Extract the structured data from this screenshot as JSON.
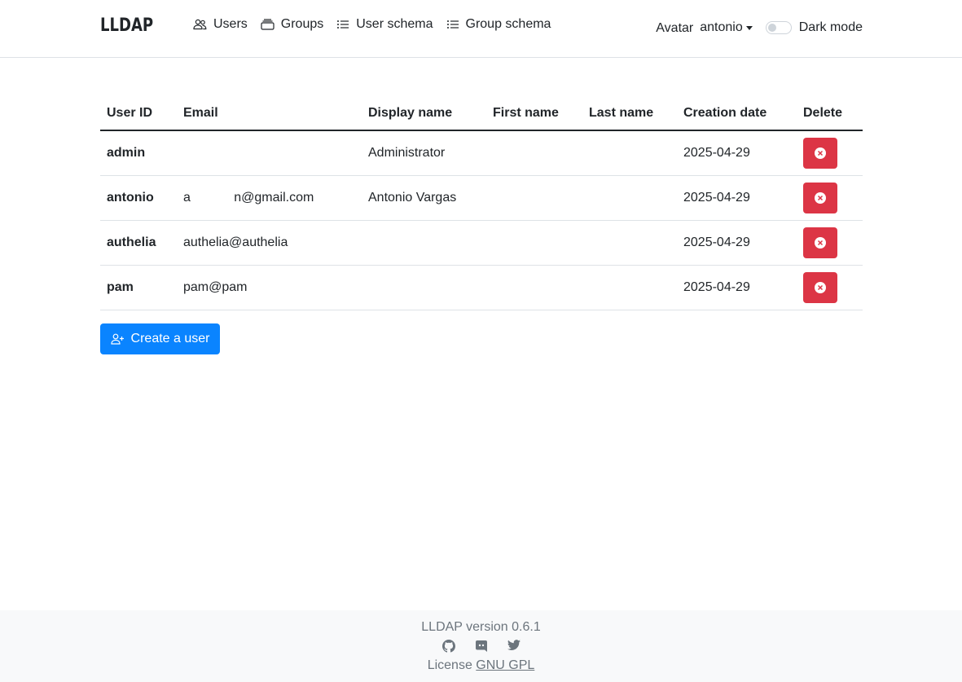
{
  "header": {
    "brand": "LLDAP",
    "nav": [
      {
        "label": "Users",
        "icon": "people-icon"
      },
      {
        "label": "Groups",
        "icon": "collection-icon"
      },
      {
        "label": "User schema",
        "icon": "list-icon"
      },
      {
        "label": "Group schema",
        "icon": "list-icon"
      }
    ],
    "avatar_label": "Avatar",
    "username": "antonio",
    "dark_mode_label": "Dark mode"
  },
  "table": {
    "columns": [
      "User ID",
      "Email",
      "Display name",
      "First name",
      "Last name",
      "Creation date",
      "Delete"
    ],
    "rows": [
      {
        "user_id": "admin",
        "email": "",
        "display_name": "Administrator",
        "first_name": "",
        "last_name": "",
        "creation_date": "2025-04-29"
      },
      {
        "user_id": "antonio",
        "email": "a            n@gmail.com",
        "display_name": "Antonio Vargas",
        "first_name": "",
        "last_name": "",
        "creation_date": "2025-04-29"
      },
      {
        "user_id": "authelia",
        "email": "authelia@authelia",
        "display_name": "",
        "first_name": "",
        "last_name": "",
        "creation_date": "2025-04-29"
      },
      {
        "user_id": "pam",
        "email": "pam@pam",
        "display_name": "",
        "first_name": "",
        "last_name": "",
        "creation_date": "2025-04-29"
      }
    ]
  },
  "create_button": "Create a user",
  "footer": {
    "version": "LLDAP version 0.6.1",
    "license_prefix": "License",
    "license_link": "GNU GPL",
    "social_icons": [
      "github-icon",
      "discord-icon",
      "twitter-icon"
    ]
  },
  "colors": {
    "primary": "#0a84ff",
    "danger": "#dc3545",
    "footer_bg": "#f8f9fa"
  }
}
